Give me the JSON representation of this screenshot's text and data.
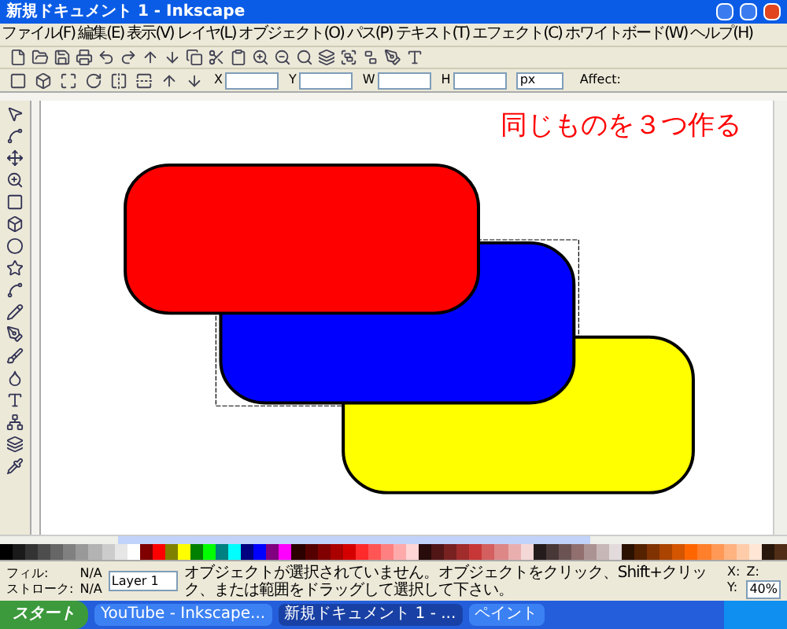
{
  "window": {
    "title": "新規ドキュメント 1 - Inkscape"
  },
  "menu": [
    "ファイル(F)",
    "編集(E)",
    "表示(V)",
    "レイヤ(L)",
    "オブジェクト(O)",
    "パス(P)",
    "テキスト(T)",
    "エフェクト(C)",
    "ホワイトボード(W)",
    "ヘルプ(H)"
  ],
  "toolbar_fields": [
    {
      "label": "X"
    },
    {
      "label": "Y"
    },
    {
      "label": "W"
    },
    {
      "label": "H"
    }
  ],
  "unit": "px",
  "affect_label": "Affect:",
  "canvas": {
    "heading": "同じものを３つ作る",
    "shapes": [
      {
        "kind": "selection-box"
      },
      {
        "kind": "rounded-rect",
        "color": "#ffff00"
      },
      {
        "kind": "rounded-rect",
        "color": "#0000ff"
      },
      {
        "kind": "rounded-rect",
        "color": "#ff0000"
      }
    ]
  },
  "palette": [
    {
      "color": "#000000"
    },
    {
      "color": "#1a1a1a"
    },
    {
      "color": "#333333"
    },
    {
      "color": "#4d4d4d"
    },
    {
      "color": "#666666"
    },
    {
      "color": "#808080"
    },
    {
      "color": "#999999"
    },
    {
      "color": "#b3b3b3"
    },
    {
      "color": "#cccccc"
    },
    {
      "color": "#e6e6e6"
    },
    {
      "color": "#ffffff"
    },
    {
      "color": "#800000"
    },
    {
      "color": "#ff0000"
    },
    {
      "color": "#808000"
    },
    {
      "color": "#ffff00"
    },
    {
      "color": "#008000"
    },
    {
      "color": "#00ff00"
    },
    {
      "color": "#008080"
    },
    {
      "color": "#00ffff"
    },
    {
      "color": "#000080"
    },
    {
      "color": "#0000ff"
    },
    {
      "color": "#800080"
    },
    {
      "color": "#ff00ff"
    },
    {
      "color": "#2b0000"
    },
    {
      "color": "#550000"
    },
    {
      "color": "#800001"
    },
    {
      "color": "#aa0000"
    },
    {
      "color": "#d40000"
    },
    {
      "color": "#ff2a2a"
    },
    {
      "color": "#ff5555"
    },
    {
      "color": "#ff8080"
    },
    {
      "color": "#ffaaaa"
    },
    {
      "color": "#ffd5d5"
    },
    {
      "color": "#280b0b"
    },
    {
      "color": "#501616"
    },
    {
      "color": "#782121"
    },
    {
      "color": "#a02c2c"
    },
    {
      "color": "#c83737"
    },
    {
      "color": "#d35f5f"
    },
    {
      "color": "#de8787"
    },
    {
      "color": "#e9afaf"
    },
    {
      "color": "#f4d7d7"
    },
    {
      "color": "#241c1c"
    },
    {
      "color": "#483737"
    },
    {
      "color": "#6c5353"
    },
    {
      "color": "#916f6f"
    },
    {
      "color": "#ac9393"
    },
    {
      "color": "#c8b7b7"
    },
    {
      "color": "#e3dbdb"
    },
    {
      "color": "#2b1100"
    },
    {
      "color": "#552200"
    },
    {
      "color": "#803300"
    },
    {
      "color": "#aa4400"
    },
    {
      "color": "#d45500"
    },
    {
      "color": "#ff6600"
    },
    {
      "color": "#ff7f2a"
    },
    {
      "color": "#ff9955"
    },
    {
      "color": "#ffb380"
    },
    {
      "color": "#ffccaa"
    },
    {
      "color": "#ffe6d5"
    },
    {
      "color": "#28170b"
    },
    {
      "color": "#502d16"
    }
  ],
  "status": {
    "fill_label": "フィル:",
    "fill_value": "N/A",
    "stroke_label": "ストローク:",
    "stroke_value": "N/A",
    "layer": "Layer 1",
    "message": "オブジェクトが選択されていません。オブジェクトをクリック、Shift+クリック、または範囲をドラッグして選択して下さい。",
    "x_label": "X:",
    "y_label": "Y:",
    "zoom_label": "Z:",
    "zoom": "40%"
  },
  "taskbar": {
    "start": "スタート",
    "tasks": [
      {
        "label": "YouTube - Inkscape...",
        "selected": false
      },
      {
        "label": "新規ドキュメント 1 - ...",
        "selected": true
      },
      {
        "label": "ペイント",
        "selected": false
      }
    ]
  }
}
